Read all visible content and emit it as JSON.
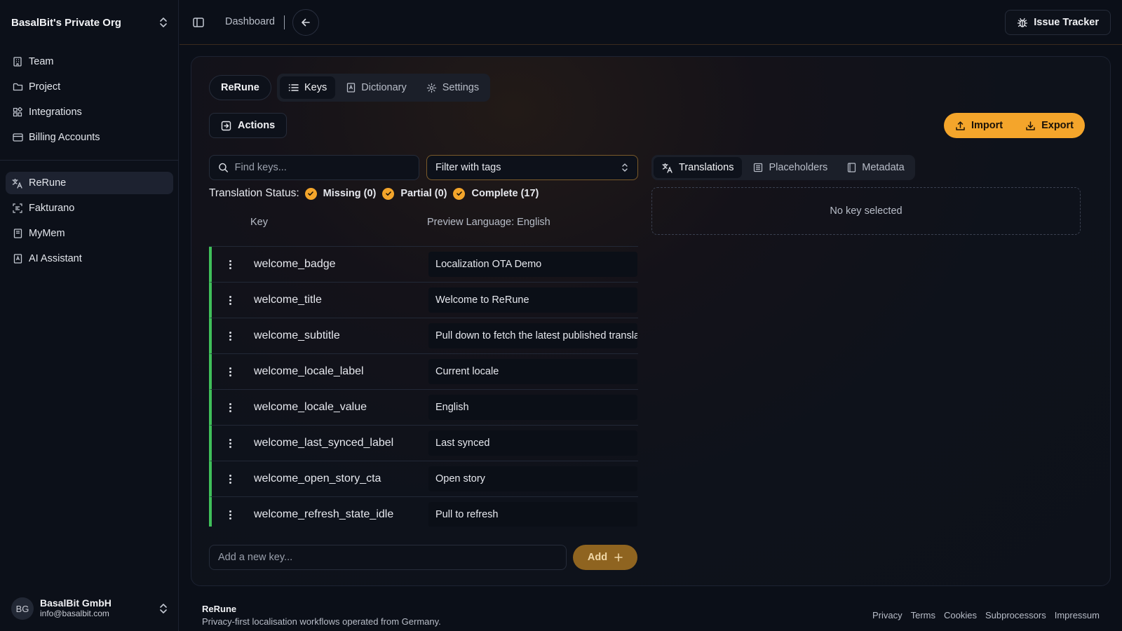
{
  "sidebar": {
    "org_name": "BasalBit's Private Org",
    "top_items": [
      {
        "label": "Team",
        "icon": "building-icon"
      },
      {
        "label": "Project",
        "icon": "folder-icon"
      },
      {
        "label": "Integrations",
        "icon": "puzzle-icon"
      },
      {
        "label": "Billing Accounts",
        "icon": "credit-card-icon"
      }
    ],
    "project_items": [
      {
        "label": "ReRune",
        "icon": "translate-icon",
        "active": true
      },
      {
        "label": "Fakturano",
        "icon": "scan-text-icon"
      },
      {
        "label": "MyMem",
        "icon": "book-icon"
      },
      {
        "label": "AI Assistant",
        "icon": "bot-icon"
      }
    ],
    "account": {
      "initials": "BG",
      "name": "BasalBit GmbH",
      "email": "info@basalbit.com"
    }
  },
  "topbar": {
    "breadcrumb": "Dashboard",
    "issue_tracker_label": "Issue Tracker"
  },
  "main": {
    "project_name": "ReRune",
    "tabs": [
      {
        "label": "Keys",
        "icon": "list-icon",
        "active": true
      },
      {
        "label": "Dictionary",
        "icon": "book-icon"
      },
      {
        "label": "Settings",
        "icon": "gear-icon"
      }
    ],
    "actions_label": "Actions",
    "import_label": "Import",
    "export_label": "Export",
    "search_placeholder": "Find keys...",
    "tag_filter_label": "Filter with tags",
    "status_label": "Translation Status:",
    "status_filters": [
      "Missing (0)",
      "Partial (0)",
      "Complete (17)"
    ],
    "columns": {
      "key": "Key",
      "preview": "Preview Language: English"
    },
    "rows": [
      {
        "key": "welcome_badge",
        "value": "Localization OTA Demo"
      },
      {
        "key": "welcome_title",
        "value": "Welcome to ReRune"
      },
      {
        "key": "welcome_subtitle",
        "value": "Pull down to fetch the latest published translations."
      },
      {
        "key": "welcome_locale_label",
        "value": "Current locale"
      },
      {
        "key": "welcome_locale_value",
        "value": "English"
      },
      {
        "key": "welcome_last_synced_label",
        "value": "Last synced"
      },
      {
        "key": "welcome_open_story_cta",
        "value": "Open story"
      },
      {
        "key": "welcome_refresh_state_idle",
        "value": "Pull to refresh"
      }
    ],
    "add_key_placeholder": "Add a new key...",
    "add_label": "Add",
    "right_tabs": [
      {
        "label": "Translations",
        "icon": "translate-icon",
        "active": true
      },
      {
        "label": "Placeholders",
        "icon": "list-details-icon"
      },
      {
        "label": "Metadata",
        "icon": "notebook-icon"
      }
    ],
    "no_key_text": "No key selected"
  },
  "footer": {
    "title": "ReRune",
    "subtitle": "Privacy-first localisation workflows operated from Germany.",
    "links": [
      "Privacy",
      "Terms",
      "Cookies",
      "Subprocessors",
      "Impressum"
    ]
  },
  "colors": {
    "accent": "#f4a52b",
    "complete_bar": "#3fbf5a",
    "background": "#0b0f18"
  }
}
